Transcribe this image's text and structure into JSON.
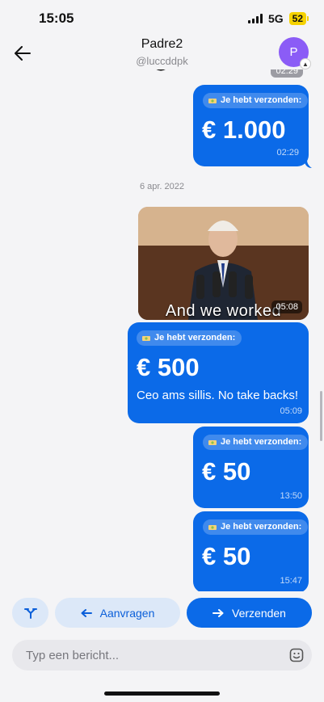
{
  "status_bar": {
    "time": "15:05",
    "network": "5G",
    "battery": "52"
  },
  "header": {
    "contact_name": "Padre2",
    "contact_handle": "@luccddpk",
    "avatar_initial": "P"
  },
  "previous_message": {
    "time": "02:29"
  },
  "messages": [
    {
      "pill": "Je hebt verzonden:",
      "amount": "€ 1.000",
      "time": "02:29"
    },
    {
      "pill": "Je hebt verzonden:",
      "amount": "€ 500",
      "note": "Ceo ams sillis. No take backs!",
      "time": "05:09"
    },
    {
      "pill": "Je hebt verzonden:",
      "amount": "€ 50",
      "time": "13:50"
    },
    {
      "pill": "Je hebt verzonden:",
      "amount": "€ 50",
      "time": "15:47"
    }
  ],
  "date_separator": "6 apr. 2022",
  "gif": {
    "caption": "And we worked",
    "time": "05:08"
  },
  "actions": {
    "request_label": "Aanvragen",
    "send_label": "Verzenden"
  },
  "composer": {
    "placeholder": "Typ een bericht..."
  },
  "colors": {
    "accent": "#0b6ae8",
    "avatar": "#8b5cf6",
    "secondary_button": "#dce8f8"
  },
  "icons": [
    "back-arrow-icon",
    "split-icon",
    "arrow-left-icon",
    "arrow-right-icon",
    "sticker-icon",
    "money-icon"
  ]
}
